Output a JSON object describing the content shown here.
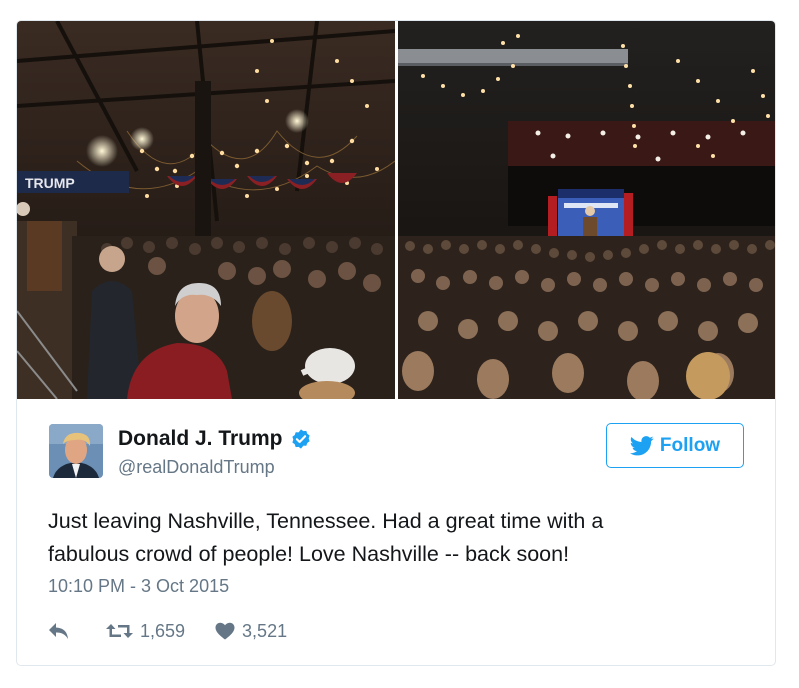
{
  "embed": {
    "photos": [
      {
        "banner_text": "TRUMP"
      },
      {
        "banner_text": ""
      }
    ],
    "author": {
      "name": "Donald J. Trump",
      "handle": "@realDonaldTrump",
      "verified": true
    },
    "follow_label": "Follow",
    "text_lines": [
      "Just leaving Nashville, Tennessee. Had a great time with a",
      "fabulous crowd of people! Love Nashville -- back soon!"
    ],
    "timestamp": "10:10 PM - 3 Oct 2015",
    "actions": {
      "retweets": "1,659",
      "likes": "3,521"
    },
    "colors": {
      "accent": "#1da1f2",
      "text": "#14171a",
      "muted": "#657786",
      "border": "#e1e8ed"
    },
    "icons": [
      "verified-badge-icon",
      "bird-icon",
      "reply-icon",
      "retweet-icon",
      "heart-icon"
    ]
  }
}
